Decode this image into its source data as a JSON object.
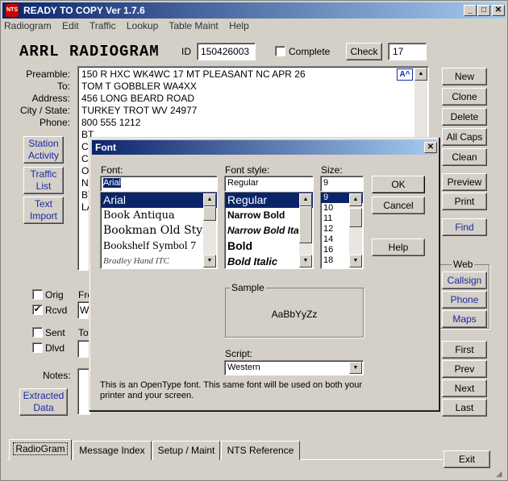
{
  "window": {
    "title": "READY TO COPY Ver 1.7.6",
    "icon_text": "NTS"
  },
  "menu": [
    "Radiogram",
    "Edit",
    "Traffic",
    "Lookup",
    "Table Maint",
    "Help"
  ],
  "header": {
    "title": "ARRL RADIOGRAM",
    "id_label": "ID",
    "id_value": "150426003",
    "complete_label": "Complete",
    "check_button": "Check",
    "check_value": "17"
  },
  "fields": {
    "labels": [
      "Preamble:",
      "To:",
      "Address:",
      "City / State:",
      "Phone:"
    ],
    "lines": [
      "150 R HXC WK4WC 17 MT PLEASANT NC APR 26",
      "TOM T GOBBLER WA4XX",
      "456 LONG BEARD ROAD",
      "TURKEY TROT WV 24977",
      "800 555 1212",
      "BT",
      "CO",
      "CA",
      "OI",
      "NI",
      "BT",
      "LA"
    ],
    "font_badge": "A^"
  },
  "left_buttons": {
    "station": "Station Activity",
    "traffic": "Traffic List",
    "text": "Text Import",
    "extracted": "Extracted Data"
  },
  "status": {
    "orig": "Orig",
    "rcvd": "Rcvd",
    "sent": "Sent",
    "dlvd": "Dlvd",
    "from_label": "Fro",
    "to_label": "To:",
    "notes_label": "Notes:",
    "from_value": "W"
  },
  "right_buttons": {
    "new": "New",
    "clone": "Clone",
    "delete": "Delete",
    "allcaps": "All Caps",
    "clean": "Clean",
    "preview": "Preview",
    "print": "Print",
    "find": "Find",
    "web_label": "Web",
    "callsign": "Callsign",
    "phone": "Phone",
    "maps": "Maps",
    "first": "First",
    "prev": "Prev",
    "next": "Next",
    "last": "Last",
    "exit": "Exit"
  },
  "tabs": [
    "RadioGram",
    "Message Index",
    "Setup / Maint",
    "NTS Reference"
  ],
  "font_dialog": {
    "title": "Font",
    "font_label": "Font:",
    "font_value": "Arial",
    "font_list": [
      "Arial",
      "Book Antiqua",
      "Bookman Old Style",
      "Bookshelf Symbol 7",
      "Bradley Hand ITC"
    ],
    "style_label": "Font style:",
    "style_value": "Regular",
    "style_list": [
      "Regular",
      "Narrow Bold",
      "Narrow Bold Italic",
      "Bold",
      "Bold Italic"
    ],
    "size_label": "Size:",
    "size_value": "9",
    "size_list": [
      "9",
      "10",
      "11",
      "12",
      "14",
      "16",
      "18"
    ],
    "ok": "OK",
    "cancel": "Cancel",
    "help": "Help",
    "sample_label": "Sample",
    "sample_text": "AaBbYyZz",
    "script_label": "Script:",
    "script_value": "Western",
    "info": "This is an OpenType font. This same font will be used on both your printer and your screen."
  }
}
